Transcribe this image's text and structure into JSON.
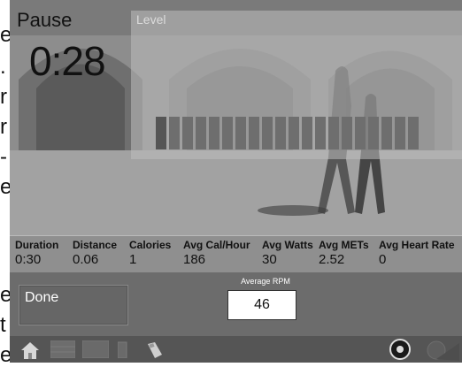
{
  "side_letters": [
    "e",
    ".",
    "r",
    "r",
    "-",
    "e",
    "e",
    "t",
    "e"
  ],
  "workout": {
    "pause_label": "Pause",
    "elapsed_time": "0:28",
    "level_label": "Level"
  },
  "level_bars": {
    "count": 20,
    "active_index": 0
  },
  "stats": [
    {
      "label": "Duration",
      "value": "0:30"
    },
    {
      "label": "Distance",
      "value": "0.06"
    },
    {
      "label": "Calories",
      "value": "1"
    },
    {
      "label": "Avg Cal/Hour",
      "value": "186"
    },
    {
      "label": "Avg Watts",
      "value": "30"
    },
    {
      "label": "Avg METs",
      "value": "2.52"
    },
    {
      "label": "Avg Heart Rate",
      "value": "0"
    }
  ],
  "controls": {
    "done_label": "Done",
    "rpm_title": "Average RPM",
    "rpm_value": "46"
  },
  "toolbar": {
    "icons": [
      "home-icon",
      "grid-icon",
      "screen-icon",
      "phone-icon",
      "usb-icon",
      "headphone-icon",
      "knob-icon"
    ]
  }
}
